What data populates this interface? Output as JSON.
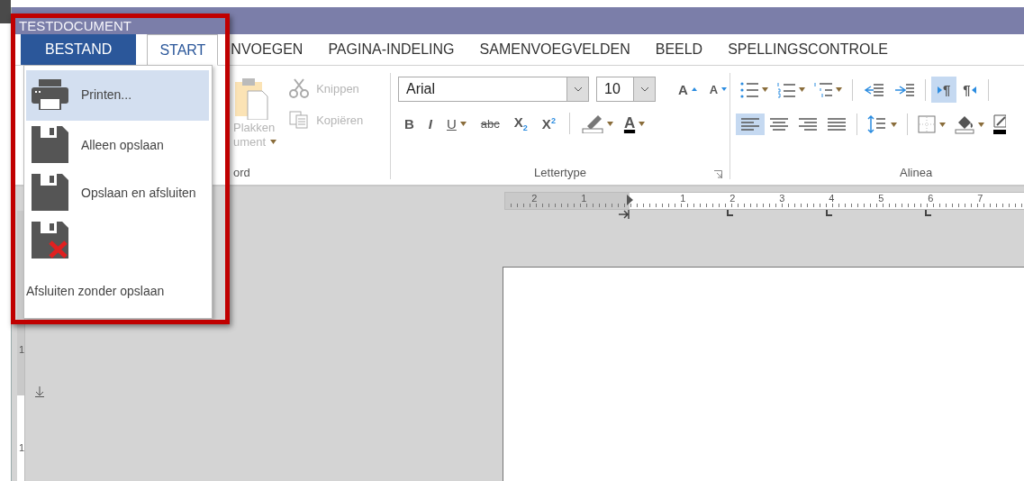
{
  "window": {
    "title": "TESTDOCUMENT"
  },
  "file_tab": {
    "label": "BESTAND",
    "open": true
  },
  "tabs": [
    {
      "label": "START",
      "selected": true
    },
    {
      "label": "NVOEGEN",
      "selected": false
    },
    {
      "label": "PAGINA-INDELING",
      "selected": false
    },
    {
      "label": "SAMENVOEGVELDEN",
      "selected": false
    },
    {
      "label": "BEELD",
      "selected": false
    },
    {
      "label": "SPELLINGSCONTROLE",
      "selected": false
    }
  ],
  "clipboard": {
    "paste_label": "Plakken",
    "paste_sublabel": "ument",
    "cut_label": "Knippen",
    "copy_label": "Kopiëren",
    "disabled": true,
    "group_label": "ord"
  },
  "font": {
    "font_name": "Arial",
    "font_size": "10",
    "grow": "A",
    "shrink": "A",
    "formats": [
      {
        "kind": "bold",
        "label": "B"
      },
      {
        "kind": "italic",
        "label": "I"
      },
      {
        "kind": "underline",
        "label": "U"
      },
      {
        "kind": "strike",
        "label": "abc"
      },
      {
        "kind": "sub",
        "label": "X$_{2}$"
      },
      {
        "kind": "sup",
        "label": "X$^{2}$"
      }
    ],
    "color_label": "A",
    "group_label": "Lettertype"
  },
  "paragraph": {
    "ltr": {
      "label": "¶",
      "selected": true
    },
    "rtl": {
      "label": "¶",
      "selected": false
    },
    "alignments": [
      {
        "kind": "left",
        "selected": true
      },
      {
        "kind": "center",
        "selected": false
      },
      {
        "kind": "right",
        "selected": false
      },
      {
        "kind": "justify",
        "selected": false
      }
    ],
    "group_label": "Alinea"
  },
  "ruler": {
    "numbers": [
      "2",
      "1",
      "1",
      "2",
      "3",
      "4",
      "5",
      "6",
      "7"
    ]
  },
  "vertical_ruler": {
    "numbers": [
      "1",
      "1"
    ]
  },
  "file_menu": {
    "items": [
      {
        "kind": "print",
        "label": "Printen...",
        "selected": true
      },
      {
        "kind": "save",
        "label": "Alleen opslaan",
        "selected": false
      },
      {
        "kind": "save",
        "label": "Opslaan en afsluiten",
        "selected": false
      },
      {
        "kind": "discard",
        "label": "Afsluiten zonder opslaan",
        "selected": false
      }
    ]
  }
}
